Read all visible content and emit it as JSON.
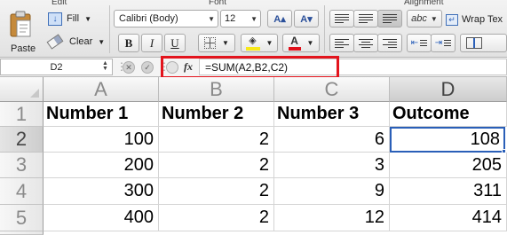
{
  "ribbon": {
    "groups": {
      "edit": "Edit",
      "font": "Font",
      "alignment": "Alignment"
    },
    "paste_label": "Paste",
    "fill_label": "Fill",
    "clear_label": "Clear",
    "font_name": "Calibri (Body)",
    "font_size": "12",
    "grow_font": "A▴",
    "shrink_font": "A▾",
    "bold": "B",
    "italic": "I",
    "underline": "U",
    "font_color_letter": "A",
    "orientation_label": "abc",
    "wrap_text_label": "Wrap Tex",
    "font_color": "#e0101a",
    "fill_color": "#f7e81a"
  },
  "formula_bar": {
    "name_box": "D2",
    "fx_label": "fx",
    "formula": "=SUM(A2,B2,C2)",
    "highlight_color": "#e3141d"
  },
  "grid": {
    "columns": [
      "A",
      "B",
      "C",
      "D"
    ],
    "rows": [
      "1",
      "2",
      "3",
      "4",
      "5"
    ],
    "header_row": [
      "Number 1",
      "Number 2",
      "Number 3",
      "Outcome"
    ],
    "data": [
      [
        "100",
        "2",
        "6",
        "108"
      ],
      [
        "200",
        "2",
        "3",
        "205"
      ],
      [
        "300",
        "2",
        "9",
        "311"
      ],
      [
        "400",
        "2",
        "12",
        "414"
      ]
    ],
    "active_cell": "D2",
    "selection_color": "#2a5fb8"
  }
}
